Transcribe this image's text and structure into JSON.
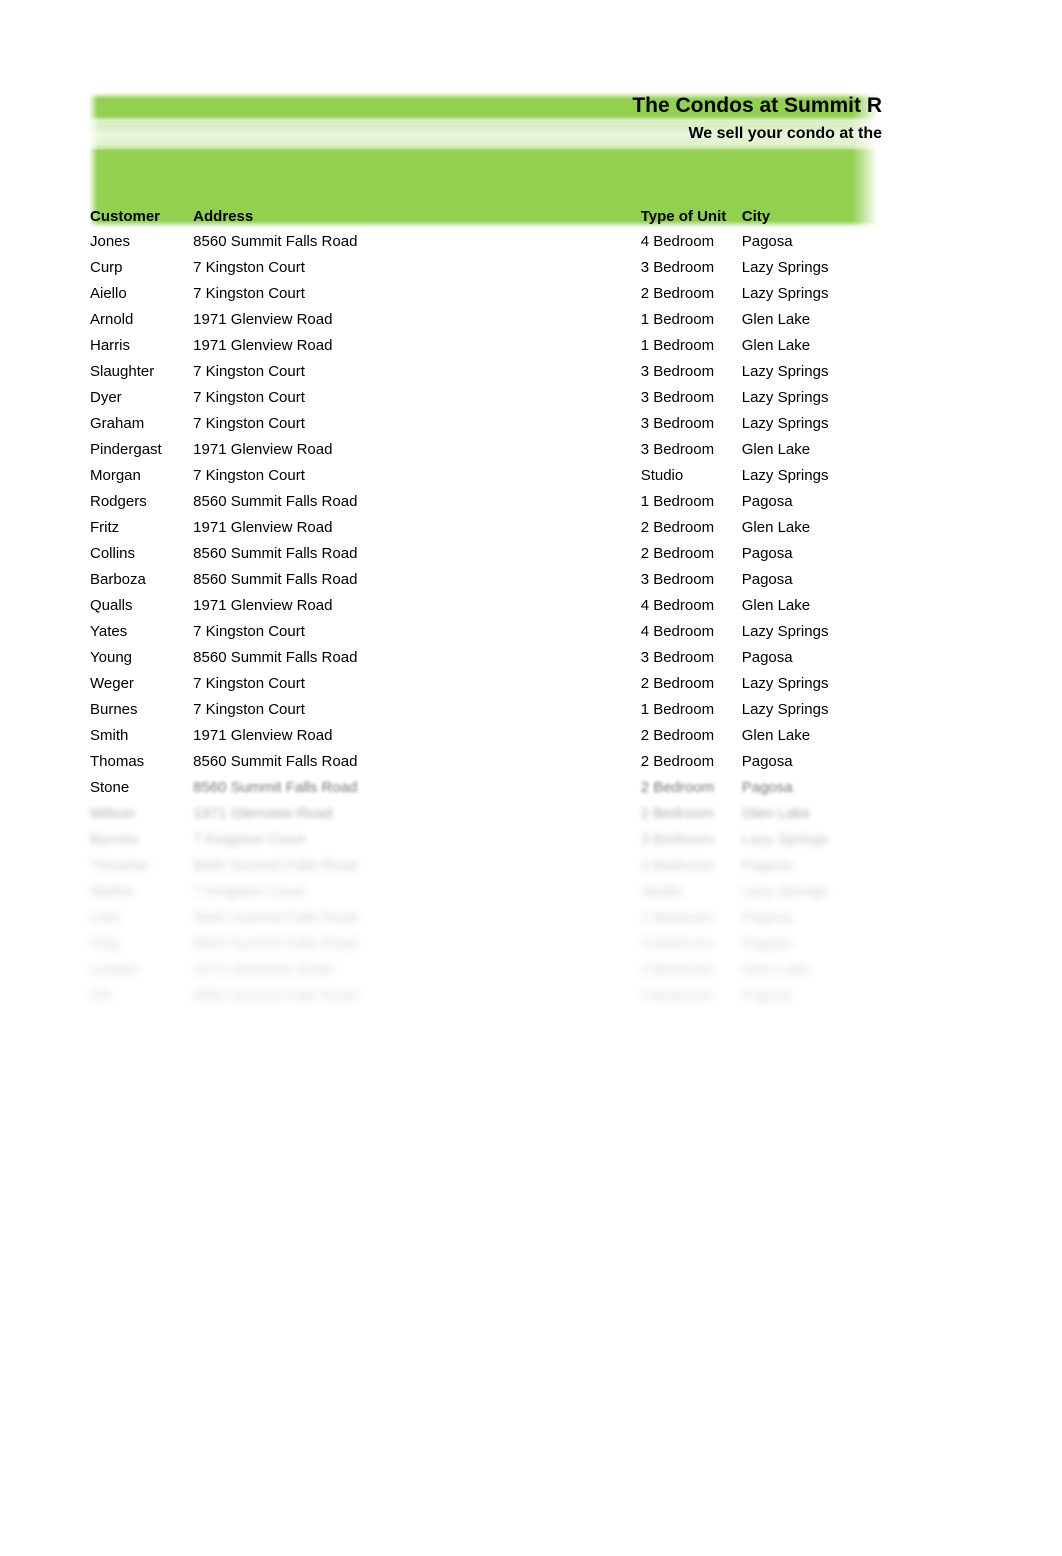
{
  "banner": {
    "company_title": "The Condos at Summit R",
    "tagline": "We sell your condo at the",
    "accent_color": "#92D050"
  },
  "table": {
    "columns": [
      {
        "key": "customer",
        "label": "Customer"
      },
      {
        "key": "address",
        "label": "Address"
      },
      {
        "key": "type_of_unit",
        "label": "Type of Unit"
      },
      {
        "key": "city",
        "label": "City"
      }
    ],
    "rows": [
      {
        "customer": "Jones",
        "address": "8560 Summit Falls Road",
        "type_of_unit": "4 Bedroom",
        "city": "Pagosa"
      },
      {
        "customer": "Curp",
        "address": "7 Kingston Court",
        "type_of_unit": "3 Bedroom",
        "city": "Lazy Springs"
      },
      {
        "customer": "Aiello",
        "address": "7 Kingston Court",
        "type_of_unit": "2 Bedroom",
        "city": "Lazy Springs"
      },
      {
        "customer": "Arnold",
        "address": "1971 Glenview Road",
        "type_of_unit": "1 Bedroom",
        "city": "Glen Lake"
      },
      {
        "customer": "Harris",
        "address": "1971 Glenview Road",
        "type_of_unit": "1 Bedroom",
        "city": "Glen Lake"
      },
      {
        "customer": "Slaughter",
        "address": "7 Kingston Court",
        "type_of_unit": "3 Bedroom",
        "city": "Lazy Springs"
      },
      {
        "customer": "Dyer",
        "address": "7 Kingston Court",
        "type_of_unit": "3 Bedroom",
        "city": "Lazy Springs"
      },
      {
        "customer": "Graham",
        "address": "7 Kingston Court",
        "type_of_unit": "3 Bedroom",
        "city": "Lazy Springs"
      },
      {
        "customer": "Pindergast",
        "address": "1971 Glenview Road",
        "type_of_unit": "3 Bedroom",
        "city": "Glen Lake"
      },
      {
        "customer": "Morgan",
        "address": "7 Kingston Court",
        "type_of_unit": "Studio",
        "city": "Lazy Springs"
      },
      {
        "customer": "Rodgers",
        "address": "8560 Summit Falls Road",
        "type_of_unit": "1 Bedroom",
        "city": "Pagosa"
      },
      {
        "customer": "Fritz",
        "address": "1971 Glenview Road",
        "type_of_unit": "2 Bedroom",
        "city": "Glen Lake"
      },
      {
        "customer": "Collins",
        "address": "8560 Summit Falls Road",
        "type_of_unit": "2 Bedroom",
        "city": "Pagosa"
      },
      {
        "customer": "Barboza",
        "address": "8560 Summit Falls Road",
        "type_of_unit": "3 Bedroom",
        "city": "Pagosa"
      },
      {
        "customer": "Qualls",
        "address": "1971 Glenview Road",
        "type_of_unit": "4 Bedroom",
        "city": "Glen Lake"
      },
      {
        "customer": "Yates",
        "address": "7 Kingston Court",
        "type_of_unit": "4 Bedroom",
        "city": "Lazy Springs"
      },
      {
        "customer": "Young",
        "address": "8560 Summit Falls Road",
        "type_of_unit": "3 Bedroom",
        "city": "Pagosa"
      },
      {
        "customer": "Weger",
        "address": "7 Kingston Court",
        "type_of_unit": "2 Bedroom",
        "city": "Lazy Springs"
      },
      {
        "customer": "Burnes",
        "address": "7 Kingston Court",
        "type_of_unit": "1 Bedroom",
        "city": "Lazy Springs"
      },
      {
        "customer": "Smith",
        "address": "1971 Glenview Road",
        "type_of_unit": "2 Bedroom",
        "city": "Glen Lake"
      },
      {
        "customer": "Thomas",
        "address": "8560 Summit Falls Road",
        "type_of_unit": "2 Bedroom",
        "city": "Pagosa"
      },
      {
        "customer": "Stone",
        "address": "8560 Summit Falls Road",
        "type_of_unit": "2 Bedroom",
        "city": "Pagosa"
      },
      {
        "customer": "Wilson",
        "address": "1971 Glenview Road",
        "type_of_unit": "2 Bedroom",
        "city": "Glen Lake"
      },
      {
        "customer": "Barnes",
        "address": "7 Kingston Court",
        "type_of_unit": "3 Bedroom",
        "city": "Lazy Springs"
      },
      {
        "customer": "Thrasher",
        "address": "8560 Summit Falls Road",
        "type_of_unit": "3 Bedroom",
        "city": "Pagosa"
      },
      {
        "customer": "Mathis",
        "address": "7 Kingston Court",
        "type_of_unit": "Studio",
        "city": "Lazy Springs"
      },
      {
        "customer": "Lord",
        "address": "8560 Summit Falls Road",
        "type_of_unit": "1 Bedroom",
        "city": "Pagosa"
      },
      {
        "customer": "King",
        "address": "8560 Summit Falls Road",
        "type_of_unit": "3 Bedroom",
        "city": "Pagosa"
      },
      {
        "customer": "Leyden",
        "address": "1971 Glenview Road",
        "type_of_unit": "2 Bedroom",
        "city": "Glen Lake"
      },
      {
        "customer": "Hill",
        "address": "8560 Summit Falls Road",
        "type_of_unit": "3 Bedroom",
        "city": "Pagosa"
      }
    ]
  }
}
